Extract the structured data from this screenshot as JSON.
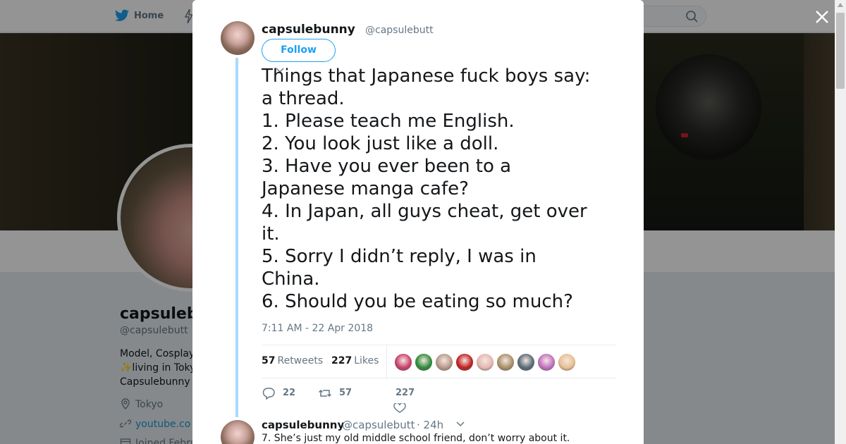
{
  "nav": {
    "home_label": "Home",
    "icons": [
      "twitter-bird-icon",
      "moments-icon",
      "search-icon"
    ]
  },
  "profile": {
    "name": "capsuleb",
    "handle": "@capsulebutt",
    "bio_lines": [
      "Model, Cosplay",
      "✨living in Toky",
      "Capsulebunny"
    ],
    "location": "Tokyo",
    "website": "youtube.co",
    "joined": "Joined Febru"
  },
  "tweet": {
    "author_name": "capsulebunny",
    "author_handle": "@capsulebutt",
    "follow_label": "Follow",
    "lines": [
      "Things that Japanese fuck boys say:",
      "a thread.",
      "1. Please teach me English.",
      "2. You look just like a doll.",
      "3. Have you ever been to a",
      "Japanese manga cafe?",
      "4. In Japan, all guys cheat, get over",
      "it.",
      "5. Sorry I didn’t reply, I was in",
      "China.",
      "6. Should you be eating so much?"
    ],
    "timestamp": "7:11 AM - 22 Apr 2018",
    "retweets_count": "57",
    "retweets_label": "Retweets",
    "likes_count": "227",
    "likes_label": "Likes",
    "liker_colors": [
      "#c9406a",
      "#2e8b3a",
      "#b89a8c",
      "#c02020",
      "#e6b8b0",
      "#a8906a",
      "#5a6a78",
      "#c070c0",
      "#e8c090"
    ],
    "actions": {
      "reply_count": "22",
      "retweet_count": "57",
      "like_count": "227"
    }
  },
  "reply": {
    "author_name": "capsulebunny",
    "author_handle": "@capsulebutt",
    "time": "· 24h",
    "text": "7. She’s just my old middle school friend, don’t worry about it."
  },
  "colors": {
    "accent": "#1da1f2",
    "thread_line": "#a9dbfc",
    "muted_text": "#657786",
    "link": "#1b95e0"
  }
}
